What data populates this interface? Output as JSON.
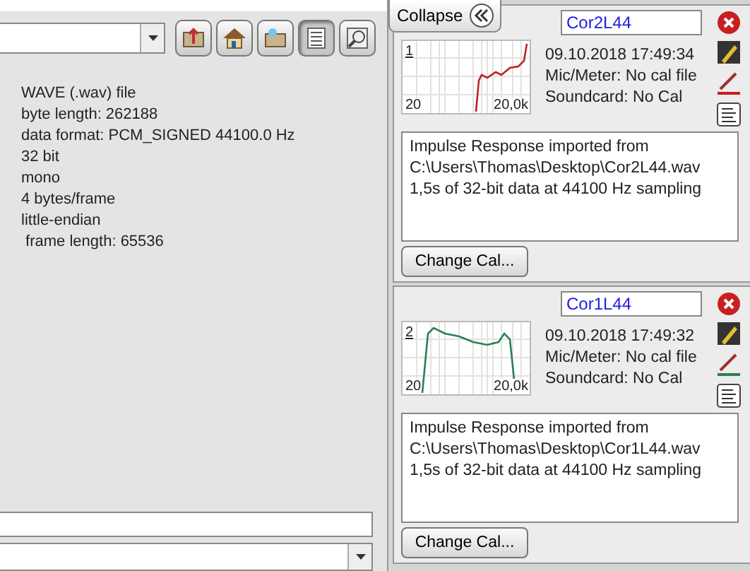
{
  "toolbar": [
    {
      "kind": "folder-up",
      "selected": false
    },
    {
      "kind": "home",
      "selected": false
    },
    {
      "kind": "new-folder",
      "selected": false
    },
    {
      "kind": "list",
      "selected": true
    },
    {
      "kind": "details",
      "selected": false
    }
  ],
  "file_info": [
    "WAVE (.wav) file",
    "byte length: 262188",
    "data format: PCM_SIGNED 44100.0 Hz",
    "32 bit",
    "mono",
    "4 bytes/frame",
    "little-endian",
    " frame length: 65536"
  ],
  "collapse_button": {
    "label": "Collapse"
  },
  "measurements": [
    {
      "name": "Cor2L44",
      "index": "1",
      "x_start": "20",
      "x_end": "20,0k",
      "color": "#c02020",
      "date": "09.10.2018 17:49:34",
      "mic": "Mic/Meter: No cal file",
      "soundcard": "Soundcard: No Cal",
      "notes": [
        "Impulse Response imported from",
        "C:\\Users\\Thomas\\Desktop\\Cor2L44.wav",
        "1,5s of 32-bit data at 44100 Hz sampling"
      ],
      "button": "Change Cal..."
    },
    {
      "name": "Cor1L44",
      "index": "2",
      "x_start": "20",
      "x_end": "20,0k",
      "color": "#2a8050",
      "date": "09.10.2018 17:49:32",
      "mic": "Mic/Meter: No cal file",
      "soundcard": "Soundcard: No Cal",
      "notes": [
        "Impulse Response imported from",
        "C:\\Users\\Thomas\\Desktop\\Cor1L44.wav",
        "1,5s of 32-bit data at 44100 Hz sampling"
      ],
      "button": "Change Cal..."
    }
  ]
}
